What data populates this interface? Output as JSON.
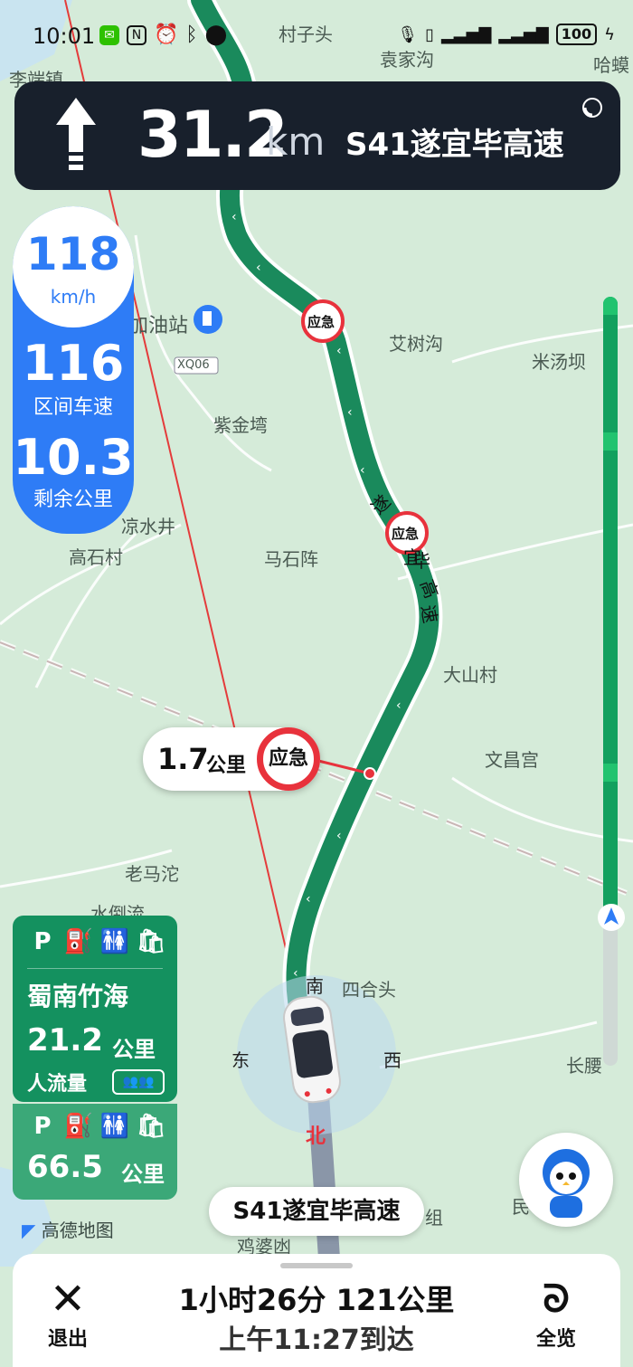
{
  "status_bar": {
    "time": "10:01",
    "battery": "100",
    "left_icons": [
      "wechat-icon",
      "nfc-icon",
      "alarm-icon",
      "bluetooth-icon",
      "location-icon"
    ],
    "right_icons": [
      "mic-icon",
      "vibrate-icon",
      "signal-icon",
      "signal-icon",
      "battery-icon",
      "charging-icon"
    ]
  },
  "nav": {
    "distance": "31.2",
    "unit": "km",
    "road": "S41遂宜毕高速",
    "direction_icon": "straight-arrow-icon"
  },
  "speed": {
    "limit": "118",
    "limit_unit": "km/h",
    "section_speed": "116",
    "section_speed_label": "区间车速",
    "remaining": "10.3",
    "remaining_label": "剩余公里"
  },
  "map": {
    "places": [
      "村子头",
      "袁家沟",
      "李端镇",
      "哈蟆",
      "艾树沟",
      "米汤坝",
      "紫金塆",
      "凉水井",
      "高石村",
      "马石阵",
      "大山村",
      "文昌宫",
      "老马沱",
      "水倒流",
      "四合头",
      "长腰",
      "鸡婆凼",
      "加油站",
      "XQ06",
      "民",
      "组"
    ],
    "road_label_chars": [
      "遂",
      "宜",
      "毕",
      "高",
      "速"
    ],
    "emergency_sign": "应急",
    "compass": {
      "south": "南",
      "east": "东",
      "west": "西",
      "north": "北"
    }
  },
  "callout": {
    "distance": "1.7",
    "unit": "公里",
    "sign": "应急"
  },
  "service_area_1": {
    "name": "蜀南竹海",
    "distance": "21.2",
    "unit": "公里",
    "flow_label": "人流量",
    "icons": [
      "P",
      "fuel-icon",
      "restroom-icon",
      "shop-icon"
    ]
  },
  "service_area_2": {
    "distance": "66.5",
    "unit": "公里",
    "icons": [
      "P",
      "fuel-icon",
      "restroom-icon",
      "shop-icon"
    ]
  },
  "progress": {
    "traveled_fraction": 0.8
  },
  "road_pill": "S41遂宜毕高速",
  "logo": "高德地图",
  "bottom": {
    "exit_label": "退出",
    "eta_line1": "1小时26分  121公里",
    "eta_line2": "上午11:27到达",
    "overview_label": "全览"
  },
  "colors": {
    "route": "#1a8a5c",
    "speed_panel": "#2e7cf6",
    "emergency": "#e8323c",
    "service_panel": "#14915f",
    "banner": "#18202c"
  }
}
